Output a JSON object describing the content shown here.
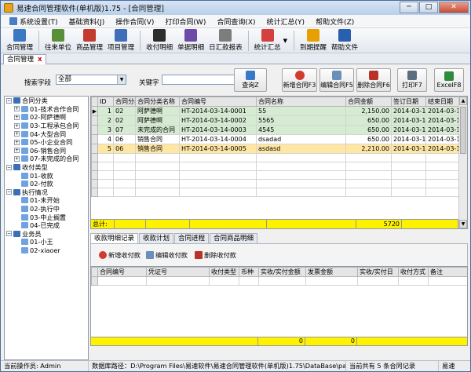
{
  "window": {
    "title": "易速合同管理软件(单机版)1.75 - [合同管理]",
    "minimize": "─",
    "maximize": "□",
    "close": "✕"
  },
  "menu": [
    "系统设置(T)",
    "基础资料(J)",
    "操作合同(V)",
    "打印合同(W)",
    "合同查询(X)",
    "统计汇总(Y)",
    "帮助文件(Z)"
  ],
  "toolbar": [
    {
      "label": "合同管理",
      "icon": "contract-icon",
      "color": "#3b78c4"
    },
    {
      "label": "往来单位",
      "icon": "people-icon",
      "color": "#5a8f3a"
    },
    {
      "label": "商品管理",
      "icon": "goods-icon",
      "color": "#c23b2e"
    },
    {
      "label": "项目管理",
      "icon": "project-icon",
      "color": "#3f6fb8"
    },
    {
      "label": "收付明细",
      "icon": "payment-icon",
      "color": "#2d2d2d"
    },
    {
      "label": "单据明细",
      "icon": "voucher-icon",
      "color": "#6b4aa8"
    },
    {
      "label": "日汇款报表",
      "icon": "report-icon",
      "color": "#7d7d7d"
    },
    {
      "label": "统计汇总",
      "icon": "chart-icon",
      "color": "#d43f3f"
    },
    {
      "label": "到期提醒",
      "icon": "alarm-clock-icon",
      "color": "#e6a100"
    },
    {
      "label": "帮助文件",
      "icon": "help-icon",
      "color": "#2a5fb0"
    }
  ],
  "doc_tab": {
    "label": "合同管理",
    "close": "x"
  },
  "search": {
    "field_label": "搜索字段",
    "field_value": "全部",
    "keyword_label": "关键字",
    "keyword_value": "",
    "buttons": {
      "query": "查询Z",
      "add": "新增合同F3",
      "edit": "编辑合同F5",
      "delete": "删除合同F6",
      "print": "打印F7",
      "excel": "ExcelF8"
    }
  },
  "tree": {
    "groups": [
      {
        "label": "合同分类",
        "children": [
          "01-技术合作合同",
          "02-阿萨德啊",
          "03-工程承包合同",
          "04-大型合同",
          "05-小企业合同",
          "06-销售合同",
          "07-未完成的合同"
        ],
        "child_expand": true
      },
      {
        "label": "收付类型",
        "children": [
          "01-收款",
          "02-付款"
        ],
        "child_expand": false
      },
      {
        "label": "执行情况",
        "children": [
          "01-未开始",
          "02-执行中",
          "03-中止搁置",
          "04-已完成"
        ],
        "child_expand": false
      },
      {
        "label": "业务员",
        "children": [
          "01-小王",
          "02-xiaoer"
        ],
        "child_expand": false
      }
    ]
  },
  "grid": {
    "columns": [
      "ID",
      "合同分类",
      "合同分类名称",
      "合同编号",
      "合同名称",
      "合同金额",
      "签订日期",
      "结束日期"
    ],
    "rows": [
      {
        "id": "1",
        "cat": "02",
        "catname": "阿萨德啊",
        "no": "HT-2014-03-14-0001",
        "name": "55",
        "amount": "2,150.00",
        "sign": "2014-03-14",
        "end": "2014-03-1"
      },
      {
        "id": "2",
        "cat": "02",
        "catname": "阿萨德啊",
        "no": "HT-2014-03-14-0002",
        "name": "5565",
        "amount": "650.00",
        "sign": "2014-03-14",
        "end": "2014-03-1"
      },
      {
        "id": "3",
        "cat": "07",
        "catname": "未完成的合同",
        "no": "HT-2014-03-14-0003",
        "name": "4545",
        "amount": "650.00",
        "sign": "2014-03-14",
        "end": "2014-03-1"
      },
      {
        "id": "4",
        "cat": "06",
        "catname": "销售合同",
        "no": "HT-2014-03-14-0004",
        "name": "dsadad",
        "amount": "650.00",
        "sign": "2014-03-14",
        "end": "2014-03-1"
      },
      {
        "id": "5",
        "cat": "06",
        "catname": "销售合同",
        "no": "HT-2014-03-14-0005",
        "name": "asdasd",
        "amount": "2,210.00",
        "sign": "2014-03-14",
        "end": "2014-03-1"
      }
    ],
    "total_label": "总计:",
    "total_amount": "5720"
  },
  "subtabs": [
    "收款明细记录",
    "收款计划",
    "合同进程",
    "合同商品明细"
  ],
  "sub_buttons": {
    "add": "新增收付款",
    "edit": "编辑收付款",
    "delete": "删除收付款"
  },
  "grid2": {
    "columns": [
      "合同编号",
      "凭证号",
      "收付类型",
      "币种",
      "实收/实付金额",
      "发票金额",
      "实收/实付日",
      "收付方式",
      "备注"
    ],
    "total_a": "0",
    "total_b": "0"
  },
  "status": {
    "operator": "当前操作员: Admin",
    "dbpath": "数据库路径：D:\\Program Files\\易速软件\\易速合同管理软件(单机版)1.75\\DataBase\\pa",
    "count": "当前共有 5 条合同记录",
    "brand": "易速"
  },
  "colors": {
    "row_green": "#d6ecd2",
    "row_selected": "#ffe7a3",
    "total_yellow": "#fff200"
  }
}
